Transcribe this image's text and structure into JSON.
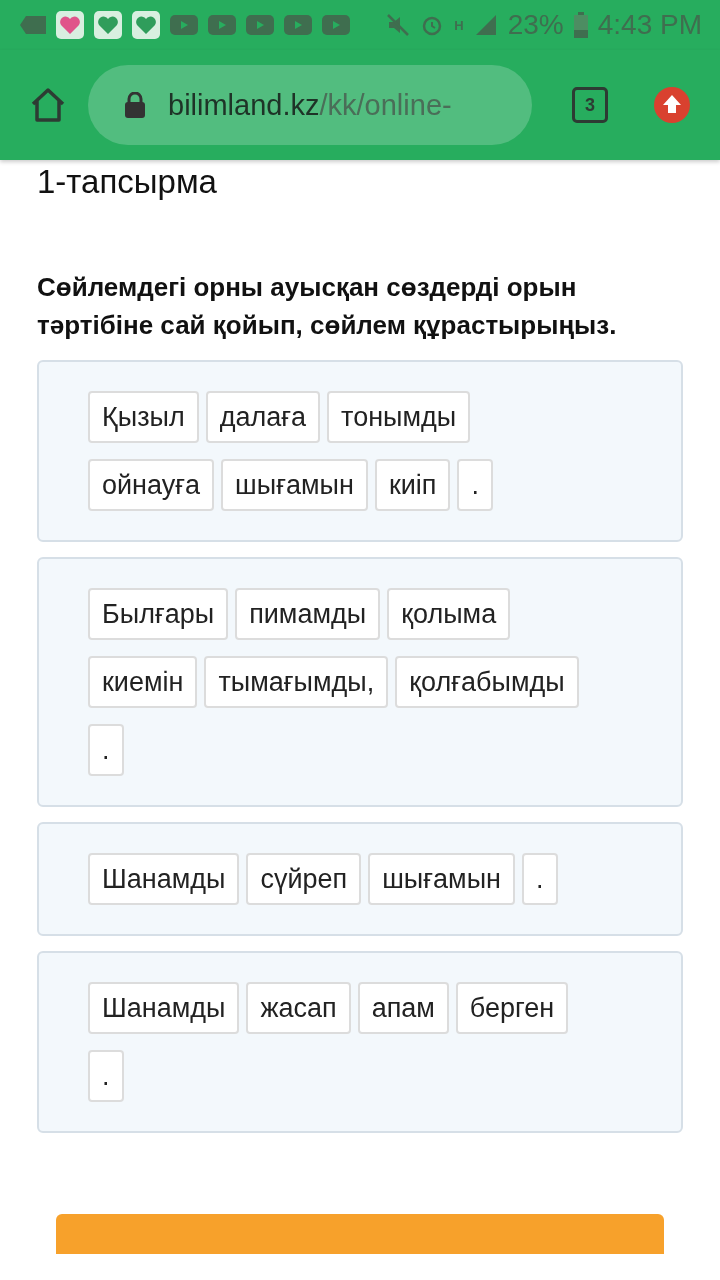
{
  "status_bar": {
    "network": "H",
    "battery": "23%",
    "time": "4:43 PM"
  },
  "browser": {
    "url_domain": "bilimland.kz",
    "url_path": "/kk/online-",
    "tab_count": "3"
  },
  "task": {
    "title": "1-тапсырма",
    "instruction": "Сөйлемдегі орны ауысқан сөздерді орын тәртібіне сай қойып, сөйлем құрастырыңыз.",
    "cards": [
      {
        "lines": [
          [
            "Қызыл",
            "далаға",
            "тонымды"
          ],
          [
            "ойнауға",
            "шығамын",
            "киіп",
            "."
          ]
        ]
      },
      {
        "lines": [
          [
            "Былғары",
            "пимамды",
            "қолыма"
          ],
          [
            "киемін",
            "тымағымды,",
            "қолғабымды"
          ],
          [
            "."
          ]
        ]
      },
      {
        "lines": [
          [
            "Шанамды",
            "сүйреп",
            "шығамын",
            "."
          ]
        ]
      },
      {
        "lines": [
          [
            "Шанамды",
            "жасап",
            "апам",
            "берген"
          ],
          [
            "."
          ]
        ]
      }
    ]
  }
}
